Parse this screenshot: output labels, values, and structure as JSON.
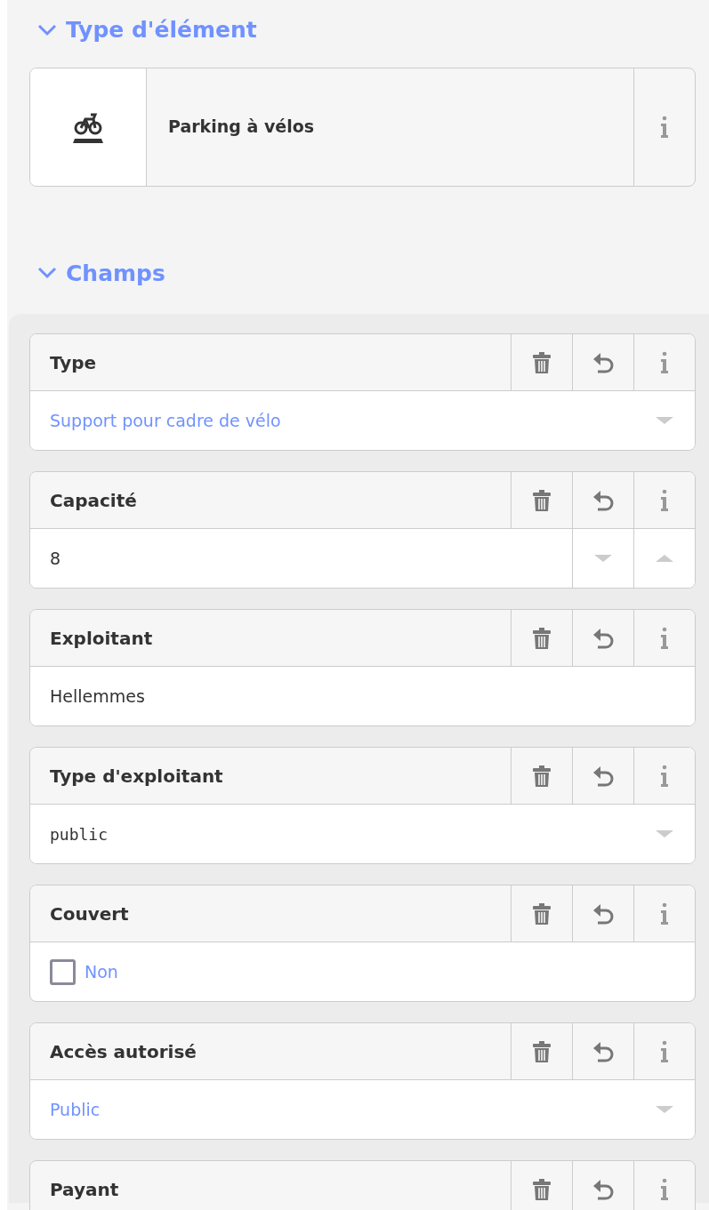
{
  "preset_section": {
    "title": "Type d'élément",
    "expanded": true,
    "preset": {
      "name": "Parking à vélos"
    }
  },
  "fields_section": {
    "title": "Champs",
    "expanded": true,
    "fields": [
      {
        "kind": "combo",
        "label": "Type",
        "value": "Support pour cadre de vélo",
        "raw": false
      },
      {
        "kind": "number",
        "label": "Capacité",
        "value": "8"
      },
      {
        "kind": "text",
        "label": "Exploitant",
        "value": "Hellemmes"
      },
      {
        "kind": "combo",
        "label": "Type d'exploitant",
        "value": "public",
        "raw": true
      },
      {
        "kind": "check",
        "label": "Couvert",
        "value": "Non",
        "checked": false
      },
      {
        "kind": "combo",
        "label": "Accès autorisé",
        "value": "Public",
        "raw": false
      },
      {
        "kind": "cut",
        "label": "Payant"
      }
    ]
  }
}
